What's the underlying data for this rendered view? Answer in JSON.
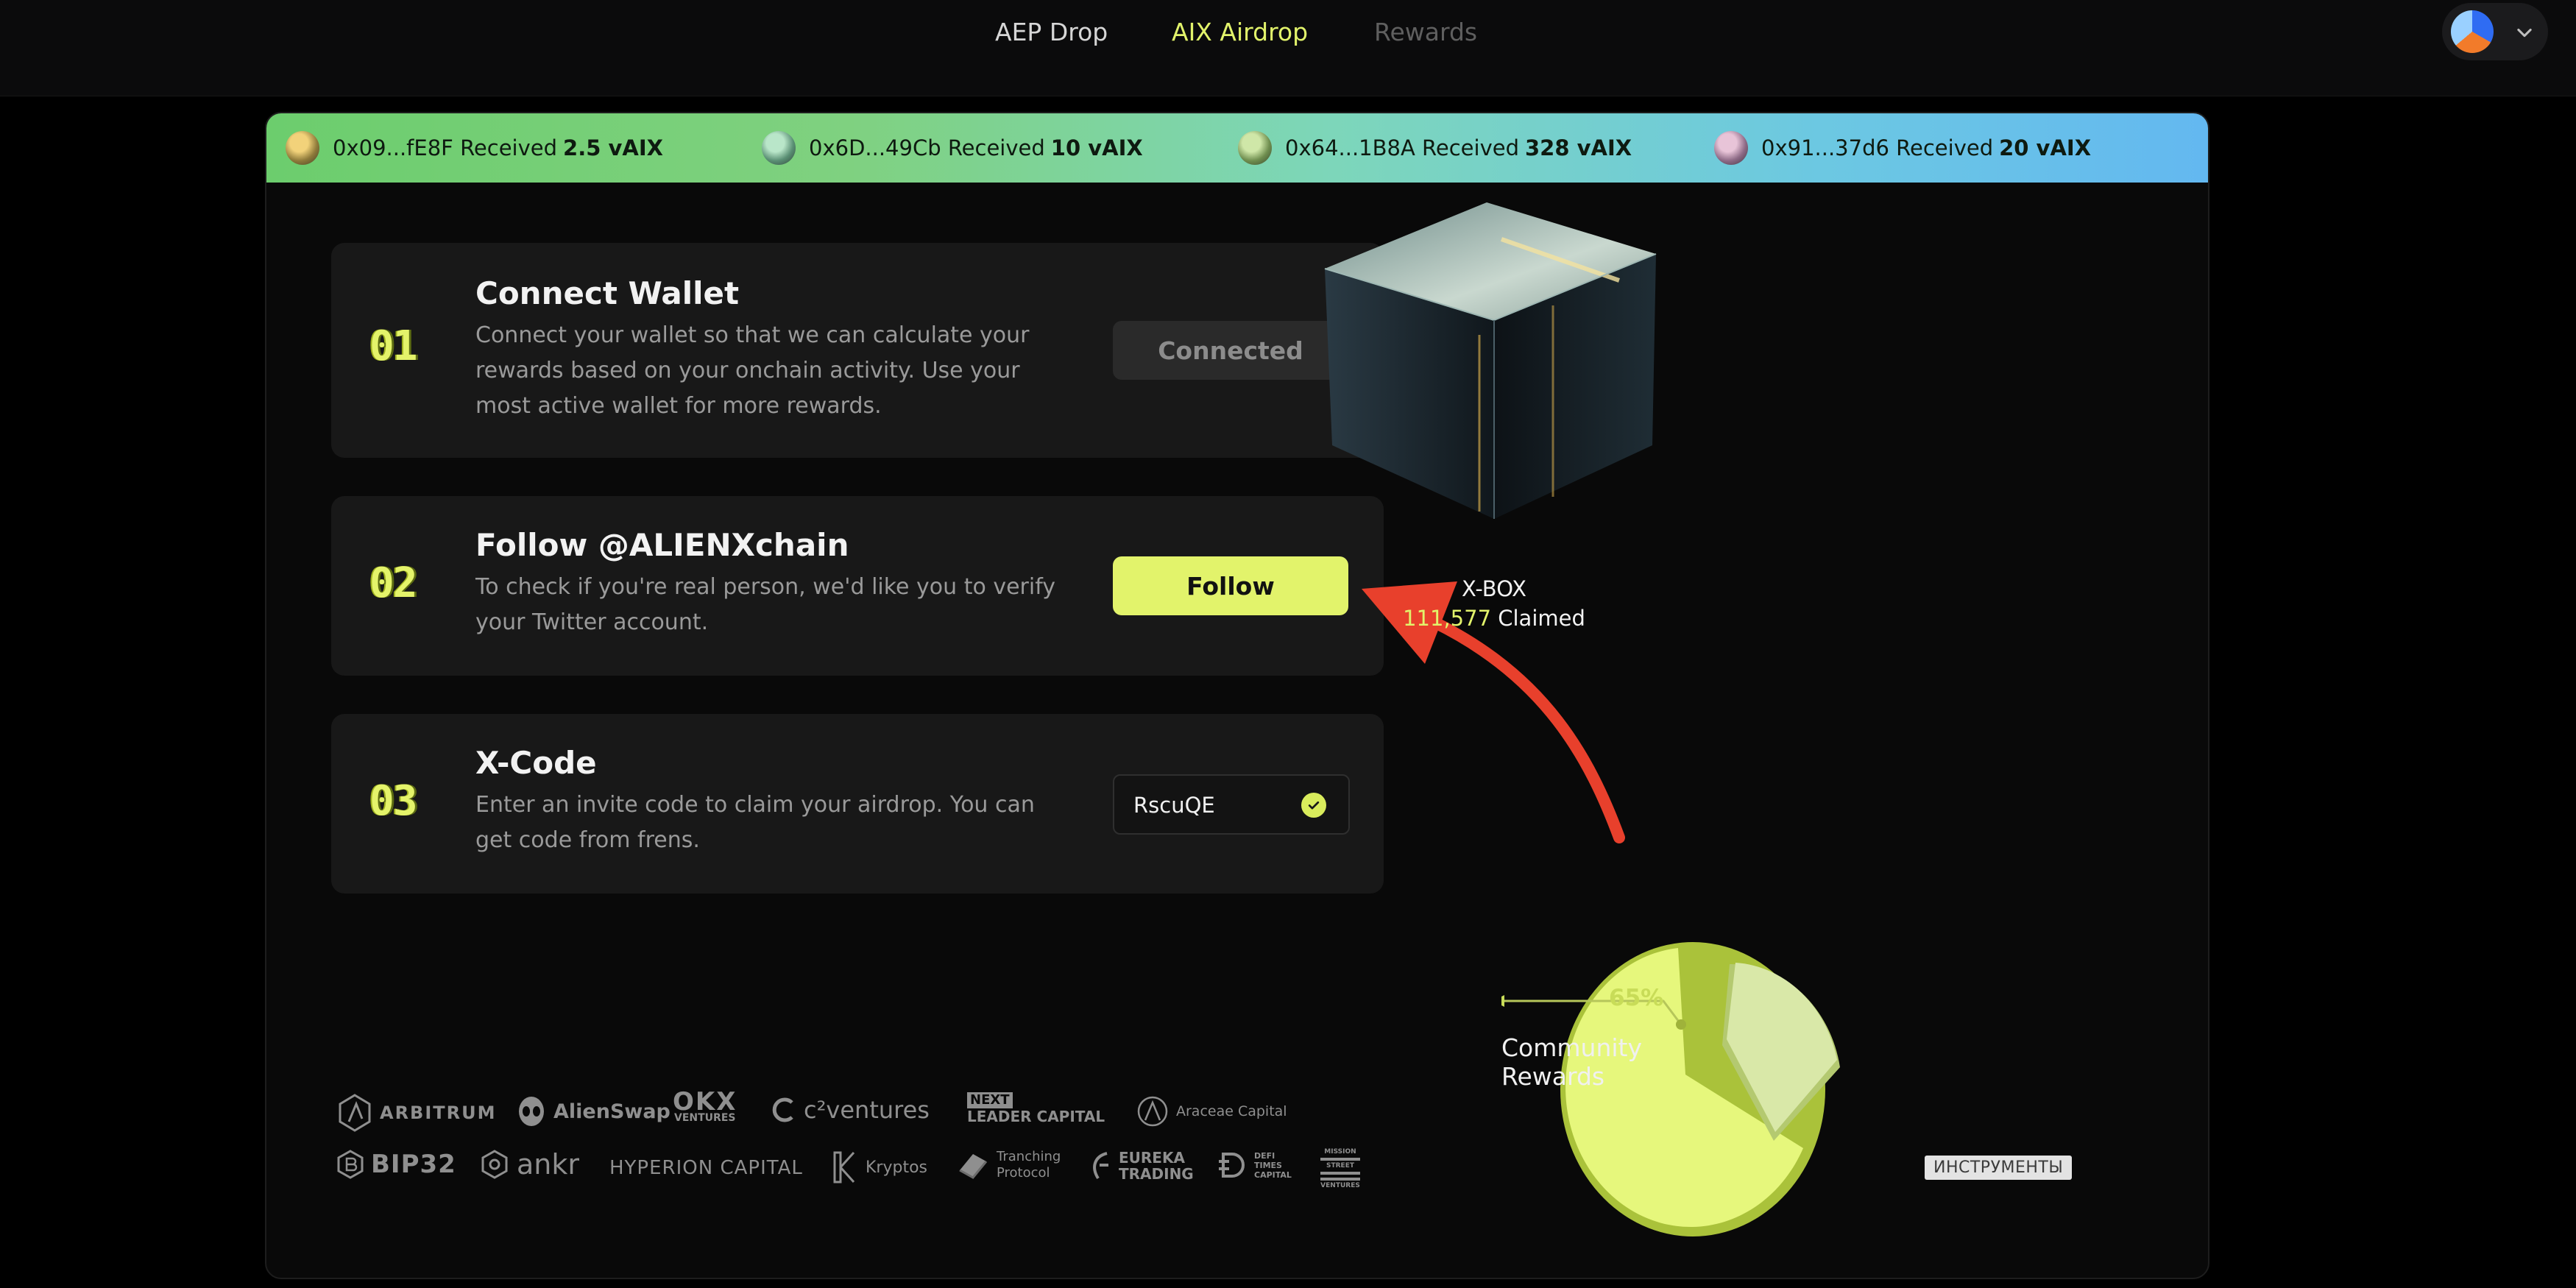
{
  "nav": {
    "tabs": [
      {
        "label": "AEP Drop",
        "state": "default"
      },
      {
        "label": "AIX Airdrop",
        "state": "active"
      },
      {
        "label": "Rewards",
        "state": "disabled"
      }
    ]
  },
  "ticker": [
    {
      "address": "0x09...fE8F",
      "verb": "Received",
      "amount": "2.5 vAIX"
    },
    {
      "address": "0x6D...49Cb",
      "verb": "Received",
      "amount": "10 vAIX"
    },
    {
      "address": "0x64...1B8A",
      "verb": "Received",
      "amount": "328 vAIX"
    },
    {
      "address": "0x91...37d6",
      "verb": "Received",
      "amount": "20 vAIX"
    }
  ],
  "steps": [
    {
      "number": "01",
      "title": "Connect Wallet",
      "description": "Connect your wallet so that we can calculate your rewards based on your onchain activity. Use your most active wallet for more rewards.",
      "action_label": "Connected"
    },
    {
      "number": "02",
      "title": "Follow @ALIENXchain",
      "description": "To check if you're real person, we'd like you to verify your Twitter account.",
      "action_label": "Follow"
    },
    {
      "number": "03",
      "title": "X-Code",
      "description": "Enter an invite code to claim your airdrop. You can get code from frens.",
      "code_value": "RscuQE"
    }
  ],
  "xbox": {
    "name": "X-BOX",
    "claimed_count": "111,577",
    "claimed_label": "Claimed"
  },
  "pie": {
    "percent_label": "65%",
    "label": "Community Rewards",
    "badge": "ИНСТРУМЕНТЫ"
  },
  "partners": {
    "row1": [
      "ARBITRUM",
      "AlienSwap",
      "OKX",
      "VENTURES",
      "c²ventures",
      "NEXT",
      "LEADER CAPITAL",
      "Araceae Capital"
    ],
    "row2": [
      "BIP32",
      "ankr",
      "HYPERION CAPITAL",
      "Kryptos",
      "Tranching",
      "Protocol",
      "EUREKA",
      "TRADING",
      "DEFI",
      "TIMES",
      "CAPITAL",
      "MISSION",
      "STREET",
      "VENTURES"
    ]
  },
  "colors": {
    "accent": "#e2f36b",
    "background": "#000000",
    "card": "#181818",
    "arrow": "#e8402c"
  }
}
